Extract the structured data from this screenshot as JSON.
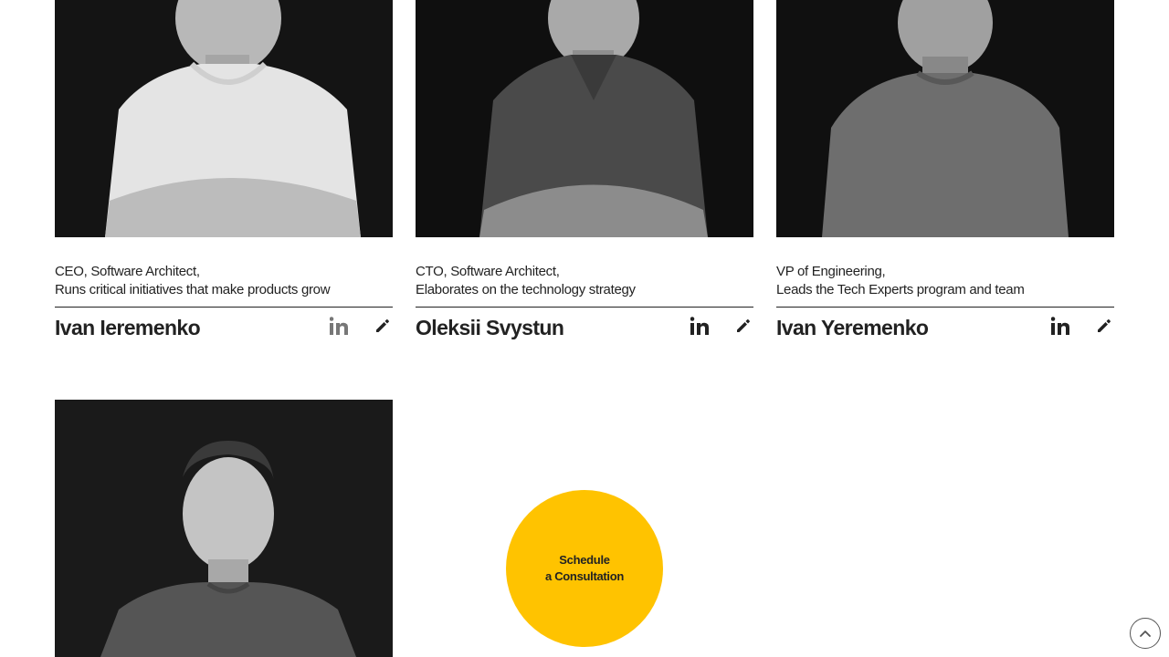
{
  "team": [
    {
      "role_line1": "CEO, Software Architect,",
      "role_line2": "Runs critical initiatives that make products grow",
      "name": "Ivan Ieremenko",
      "photo_alt": "Ivan Ieremenko portrait",
      "linkedin_icon": "linkedin-icon",
      "edit_icon": "pencil-icon"
    },
    {
      "role_line1": "CTO, Software Architect,",
      "role_line2": "Elaborates on the technology strategy",
      "name": "Oleksii Svystun",
      "photo_alt": "Oleksii Svystun portrait",
      "linkedin_icon": "linkedin-icon",
      "edit_icon": "pencil-icon"
    },
    {
      "role_line1": "VP of Engineering,",
      "role_line2": "Leads the Tech Experts program and team",
      "name": "Ivan Yeremenko",
      "photo_alt": "Ivan Yeremenko portrait",
      "linkedin_icon": "linkedin-icon",
      "edit_icon": "pencil-icon"
    },
    {
      "photo_alt": "Team member portrait"
    }
  ],
  "cta": {
    "line1": "Schedule",
    "line2": "a Consultation",
    "color": "#ffc300"
  },
  "scroll_top": {
    "icon": "chevron-up-icon"
  }
}
